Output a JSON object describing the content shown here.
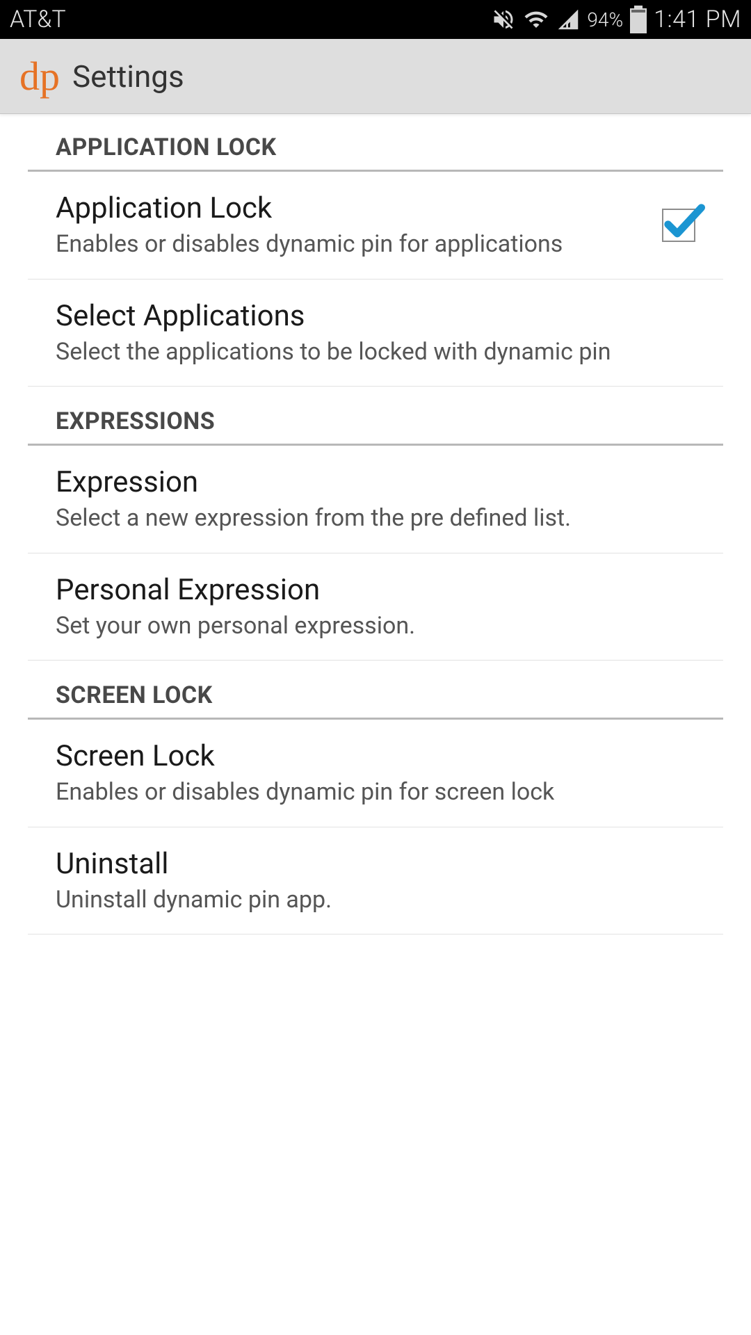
{
  "statusBar": {
    "carrier": "AT&T",
    "batteryPct": "94%",
    "time": "1:41 PM"
  },
  "header": {
    "logoText": "dp",
    "title": "Settings"
  },
  "sections": [
    {
      "header": "APPLICATION LOCK",
      "rows": [
        {
          "title": "Application Lock",
          "sub": "Enables or disables dynamic pin for applications",
          "hasCheckbox": true,
          "checked": true
        },
        {
          "title": "Select Applications",
          "sub": "Select the applications to be locked with dynamic pin",
          "hasCheckbox": false
        }
      ]
    },
    {
      "header": "EXPRESSIONS",
      "rows": [
        {
          "title": "Expression",
          "sub": "Select a new expression from the pre defined list.",
          "hasCheckbox": false
        },
        {
          "title": "Personal Expression",
          "sub": "Set your own personal expression.",
          "hasCheckbox": false
        }
      ]
    },
    {
      "header": "SCREEN LOCK",
      "rows": [
        {
          "title": "Screen Lock",
          "sub": "Enables or disables dynamic pin for screen lock",
          "hasCheckbox": false
        },
        {
          "title": "Uninstall",
          "sub": "Uninstall dynamic pin app.",
          "hasCheckbox": false
        }
      ]
    }
  ]
}
